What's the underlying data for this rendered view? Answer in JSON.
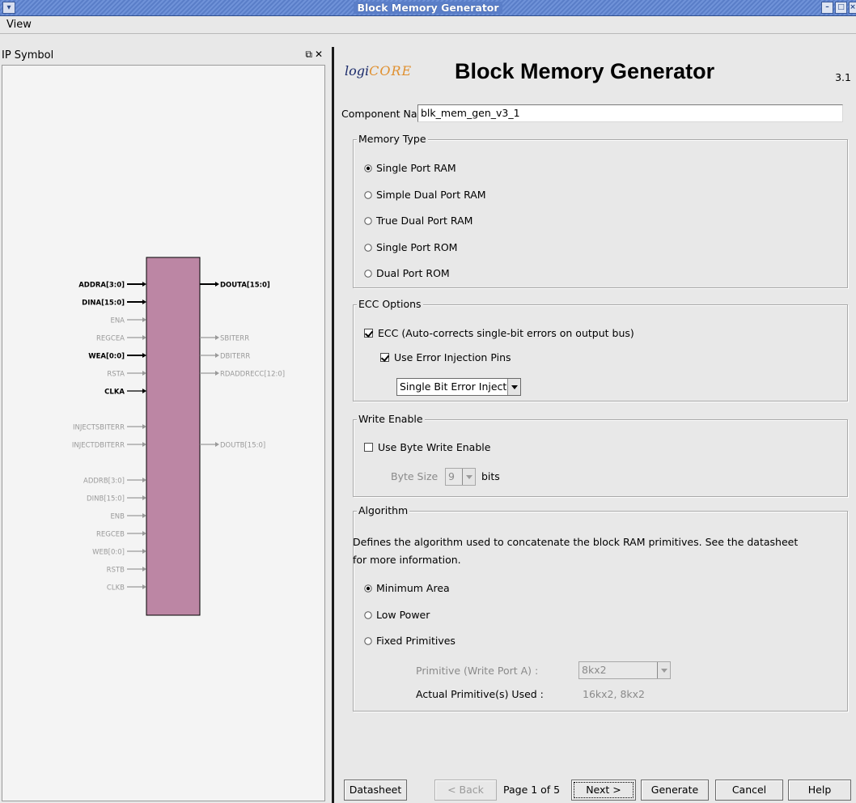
{
  "window": {
    "title": "Block Memory Generator"
  },
  "menu": {
    "view_label": "View"
  },
  "left_panel": {
    "title": "IP Symbol",
    "symbol": {
      "left_pins": [
        {
          "label": "ADDRA[3:0]",
          "active": true,
          "bus": true
        },
        {
          "label": "DINA[15:0]",
          "active": true,
          "bus": true
        },
        {
          "label": "ENA",
          "active": false,
          "bus": false
        },
        {
          "label": "REGCEA",
          "active": false,
          "bus": false
        },
        {
          "label": "WEA[0:0]",
          "active": true,
          "bus": true
        },
        {
          "label": "RSTA",
          "active": false,
          "bus": false
        },
        {
          "label": "CLKA",
          "active": true,
          "bus": false
        },
        {
          "label": "INJECTSBITERR",
          "active": false,
          "bus": false
        },
        {
          "label": "INJECTDBITERR",
          "active": false,
          "bus": false
        },
        {
          "label": "ADDRB[3:0]",
          "active": false,
          "bus": true
        },
        {
          "label": "DINB[15:0]",
          "active": false,
          "bus": true
        },
        {
          "label": "ENB",
          "active": false,
          "bus": false
        },
        {
          "label": "REGCEB",
          "active": false,
          "bus": false
        },
        {
          "label": "WEB[0:0]",
          "active": false,
          "bus": false
        },
        {
          "label": "RSTB",
          "active": false,
          "bus": false
        },
        {
          "label": "CLKB",
          "active": false,
          "bus": false
        }
      ],
      "right_pins": [
        {
          "label": "DOUTA[15:0]",
          "active": true,
          "bus": true
        },
        {
          "label": "SBITERR",
          "active": false,
          "bus": false
        },
        {
          "label": "DBITERR",
          "active": false,
          "bus": false
        },
        {
          "label": "RDADDRECC[12:0]",
          "active": false,
          "bus": false
        },
        {
          "label": "DOUTB[15:0]",
          "active": false,
          "bus": false
        }
      ],
      "colors": {
        "block": "#bc86a4",
        "active": "#000000",
        "inactive": "#9a9a9a"
      }
    }
  },
  "header": {
    "logo_logi": "logi",
    "logo_core": "CORE",
    "title": "Block Memory Generator",
    "version": "3.1"
  },
  "component": {
    "label": "Component Name",
    "value": "blk_mem_gen_v3_1"
  },
  "memory_type": {
    "title": "Memory Type",
    "options": [
      {
        "label": "Single Port RAM",
        "selected": true
      },
      {
        "label": "Simple Dual Port RAM",
        "selected": false
      },
      {
        "label": "True Dual Port RAM",
        "selected": false
      },
      {
        "label": "Single Port ROM",
        "selected": false
      },
      {
        "label": "Dual Port ROM",
        "selected": false
      }
    ]
  },
  "ecc": {
    "title": "ECC Options",
    "ecc_label": "ECC (Auto-corrects single-bit errors on output bus)",
    "ecc_checked": true,
    "inject_label": "Use Error Injection Pins",
    "inject_checked": true,
    "inject_mode": "Single Bit Error Injecti"
  },
  "write_enable": {
    "title": "Write Enable",
    "byte_we_label": "Use Byte Write Enable",
    "byte_we_checked": false,
    "byte_size_label": "Byte Size",
    "byte_size_value": "9",
    "bits_label": "bits"
  },
  "algorithm": {
    "title": "Algorithm",
    "desc_line1": "Defines the algorithm used to concatenate the block RAM primitives.  See the datasheet",
    "desc_line2": "for more information.",
    "options": [
      {
        "label": "Minimum Area",
        "selected": true
      },
      {
        "label": "Low Power",
        "selected": false
      },
      {
        "label": "Fixed Primitives",
        "selected": false
      }
    ],
    "primitive_label": "Primitive (Write Port A) :",
    "primitive_value": "8kx2",
    "actual_label": "Actual Primitive(s) Used :",
    "actual_value": "16kx2, 8kx2"
  },
  "footer": {
    "datasheet": "Datasheet",
    "back": "< Back",
    "page": "Page 1 of 5",
    "next": "Next >",
    "generate": "Generate",
    "cancel": "Cancel",
    "help": "Help"
  }
}
